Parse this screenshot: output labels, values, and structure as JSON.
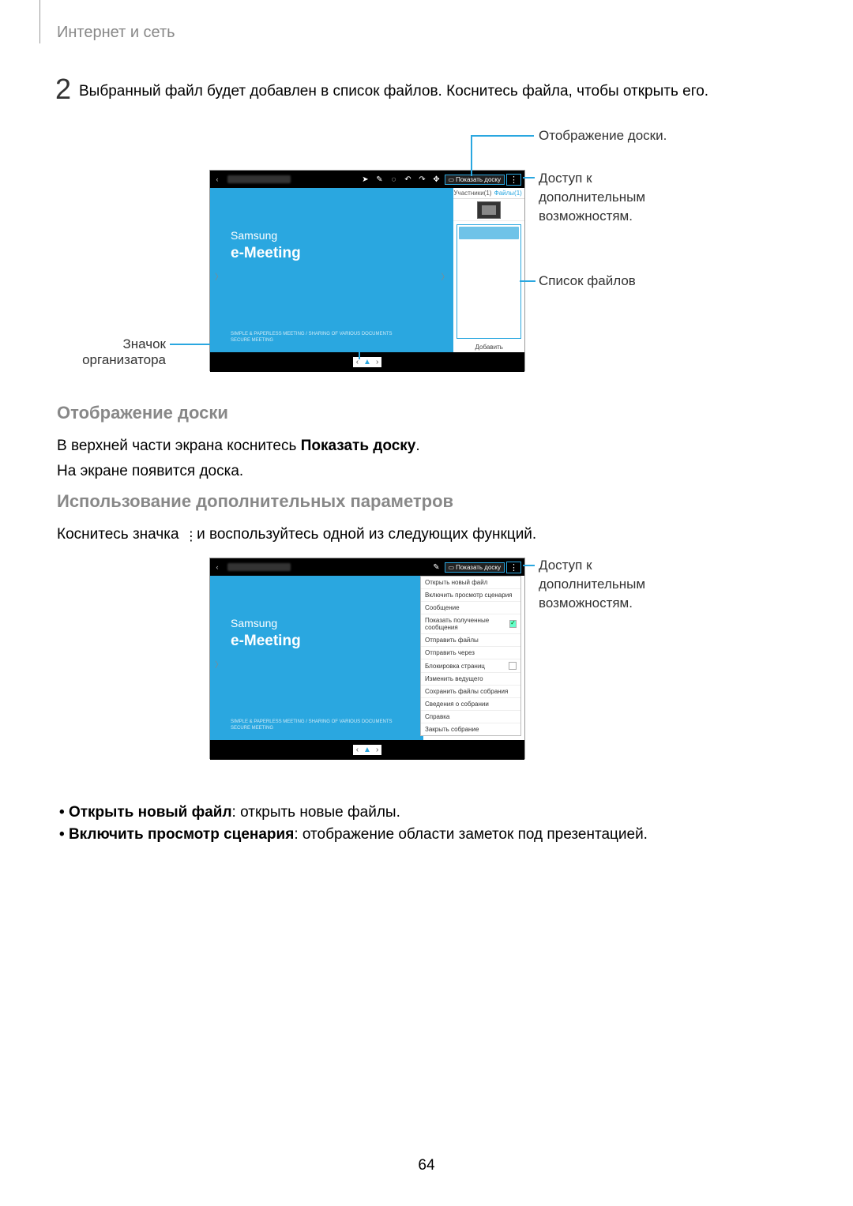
{
  "breadcrumb": "Интернет и сеть",
  "step": {
    "num": "2",
    "text": "Выбранный файл будет добавлен в список файлов. Коснитесь файла, чтобы открыть его."
  },
  "callouts": {
    "board": "Отображение доски.",
    "more1": "Доступ к",
    "more2": "дополнительным",
    "more3": "возможностям.",
    "files": "Список файлов",
    "organizer": "Значок организатора"
  },
  "fig_app": {
    "back": "‹",
    "show_board": "Показать доску",
    "participants_tab": "Участники(1)",
    "files_tab": "Файлы(1)",
    "add": "Добавить",
    "samsung": "Samsung",
    "emeeting": "e-Meeting",
    "tagline1": "SIMPLE & PAPERLESS MEETING / SHARING OF VARIOUS DOCUMENTS",
    "tagline2": "SECURE MEETING",
    "pager_prev": "‹",
    "pager_org": "▲",
    "pager_next": "›"
  },
  "section_board_h": "Отображение доски",
  "section_board_p1a": "В верхней части экрана коснитесь ",
  "section_board_p1b": "Показать доску",
  "section_board_p1c": ".",
  "section_board_p2": "На экране появится доска.",
  "section_more_h": "Использование дополнительных параметров",
  "section_more_p_a": "Коснитесь значка ",
  "section_more_p_b": " и воспользуйтесь одной из следующих функций.",
  "menu": [
    "Открыть новый файл",
    "Включить просмотр сценария",
    "Сообщение",
    "Показать полученные сообщения",
    "Отправить файлы",
    "Отправить через",
    "Блокировка страниц",
    "Изменить ведущего",
    "Сохранить файлы собрания",
    "Сведения о собрании",
    "Справка",
    "Закрыть собрание"
  ],
  "callouts2": {
    "more1": "Доступ к",
    "more2": "дополнительным",
    "more3": "возможностям."
  },
  "bullets": {
    "b1a": "Открыть новый файл",
    "b1b": ": открыть новые файлы.",
    "b2a": "Включить просмотр сценария",
    "b2b": ": отображение области заметок под презентацией."
  },
  "page": "64"
}
